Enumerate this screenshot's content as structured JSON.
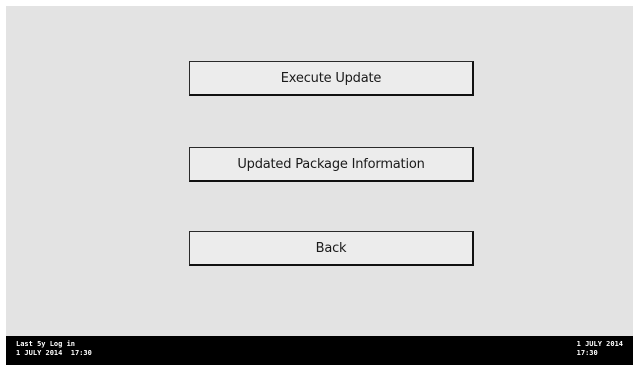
{
  "menu": {
    "execute_update_label": "Execute Update",
    "package_info_label": "Updated Package Information",
    "back_label": "Back"
  },
  "status_bar": {
    "left_line1": "Last 5y Log in",
    "left_line2": "1 JULY 2014  17:30",
    "right_line1": "1 JULY 2014",
    "right_line2": "17:30"
  },
  "colors": {
    "background": "#e3e3e3",
    "status_bar": "#000000",
    "button_border": "#1a1a1a"
  }
}
